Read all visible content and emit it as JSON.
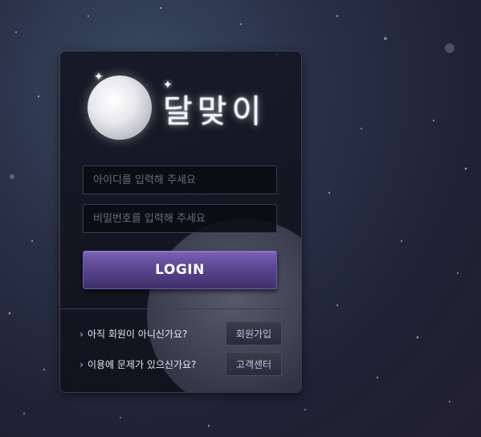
{
  "logo": {
    "title": "달맞이",
    "icon": "moon-icon"
  },
  "login_form": {
    "id_placeholder": "아이디를 입력해 주세요",
    "password_placeholder": "비밀번호를 입력해 주세요",
    "login_label": "LOGIN"
  },
  "links": {
    "signup_prompt": "아직 회원이 아니신가요?",
    "signup_button": "회원가입",
    "help_prompt": "이용에 문제가 있으신가요?",
    "help_button": "고객센터"
  },
  "colors": {
    "accent": "#5a4790",
    "chevron": "#9e8ad8",
    "panel": "#14161f"
  }
}
